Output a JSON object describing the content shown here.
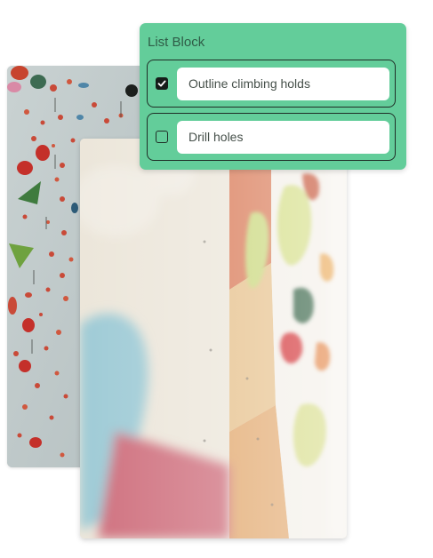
{
  "list_block": {
    "title": "List Block",
    "items": [
      {
        "text": "Outline climbing holds",
        "checked": true
      },
      {
        "text": "Drill holes",
        "checked": false
      }
    ]
  },
  "colors": {
    "panel_green": "#63cd9a",
    "panel_border": "#1f2d26",
    "checkbox_checked": "#151d19"
  },
  "icons": {
    "checkmark": "checkmark-icon"
  }
}
